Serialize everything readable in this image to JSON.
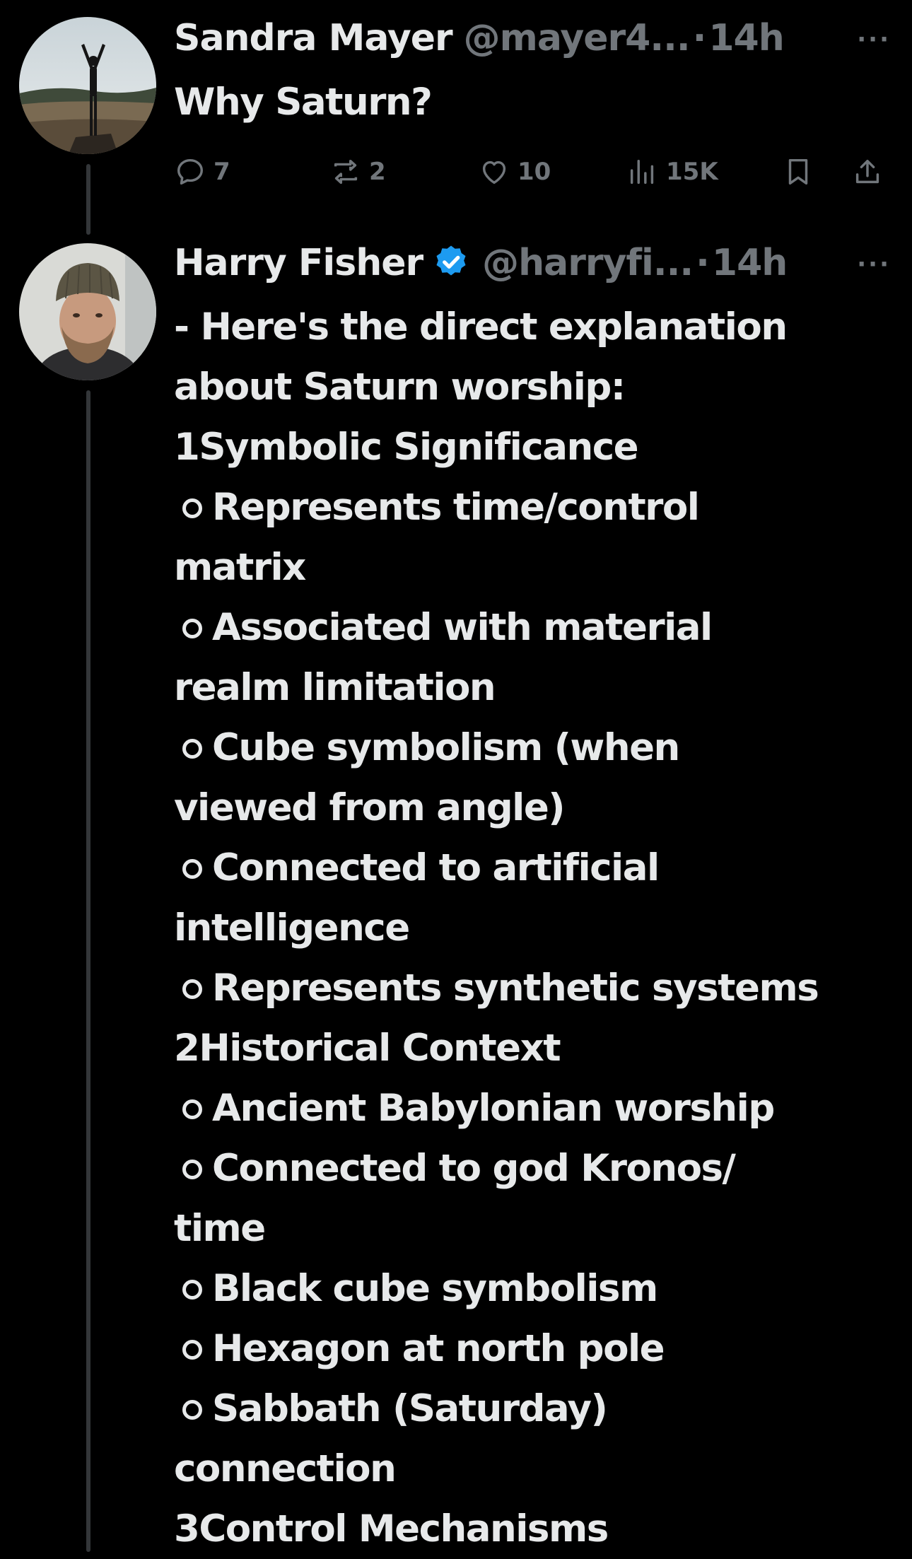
{
  "tweet1": {
    "name": "Sandra Mayer",
    "handle": "@mayer4...",
    "dot": "·",
    "time": "14h",
    "more": "···",
    "text": "Why Saturn?",
    "actions": {
      "replies": "7",
      "reposts": "2",
      "likes": "10",
      "views": "15K"
    }
  },
  "tweet2": {
    "name": "Harry Fisher",
    "handle": "@harryfi...",
    "dot": "·",
    "time": "14h",
    "more": "···",
    "verified_color": "#1d9bf0",
    "lines": [
      "- Here's the direct explanation",
      "about Saturn worship:",
      "1Symbolic Significance",
      "Represents time/control",
      "matrix",
      "Associated with material",
      "realm limitation",
      "Cube symbolism (when",
      "viewed from angle)",
      "Connected to artificial",
      "intelligence",
      "Represents synthetic systems",
      "2Historical Context",
      "Ancient Babylonian worship",
      "Connected to god Kronos/",
      "time",
      "Black cube symbolism",
      "Hexagon at north pole",
      "Sabbath (Saturday)",
      "connection",
      "3Control Mechanisms"
    ]
  }
}
